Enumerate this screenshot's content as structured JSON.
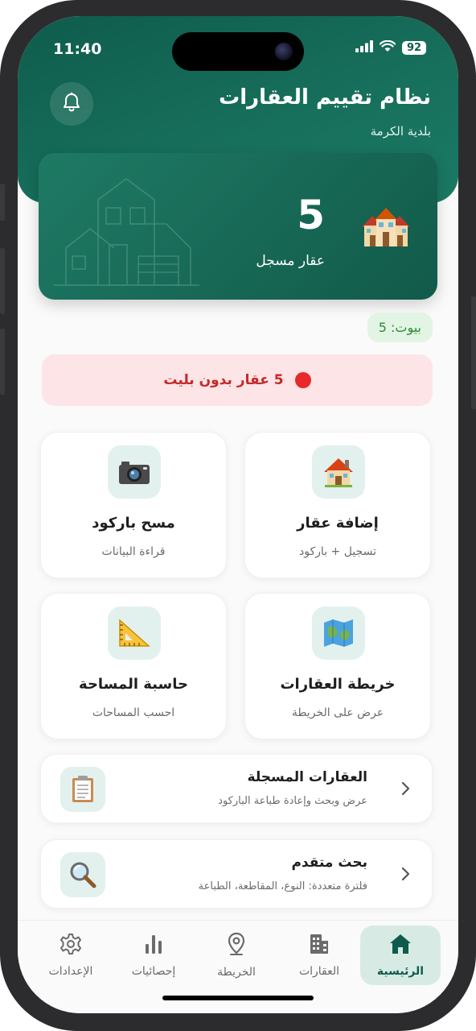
{
  "status_bar": {
    "time": "11:40",
    "battery": "92"
  },
  "header": {
    "title": "نظام تقييم العقارات",
    "subtitle": "بلدية الكرمة"
  },
  "stats": {
    "count": "5",
    "label": "عقار مسجل"
  },
  "homes_badge": "بيوت: 5",
  "alert": {
    "text": "5 عقار بدون بليت",
    "color": "#e8282b"
  },
  "grid": [
    {
      "title": "إضافة عقار",
      "subtitle": "تسجيل + باركود",
      "icon": "house-icon"
    },
    {
      "title": "مسح باركود",
      "subtitle": "قراءة البيانات",
      "icon": "camera-icon"
    },
    {
      "title": "خريطة العقارات",
      "subtitle": "عرض على الخريطة",
      "icon": "map-icon"
    },
    {
      "title": "حاسبة المساحة",
      "subtitle": "احسب المساحات",
      "icon": "triangle-ruler-icon"
    }
  ],
  "list": [
    {
      "title": "العقارات المسجلة",
      "subtitle": "عرض وبحث وإعادة طباعة الباركود",
      "icon": "clipboard-icon"
    },
    {
      "title": "بحث متقدم",
      "subtitle": "فلترة متعددة: النوع، المقاطعة، الطباعة",
      "icon": "magnifier-icon"
    }
  ],
  "nav": [
    {
      "label": "الرئيسية",
      "icon": "home-icon",
      "active": true
    },
    {
      "label": "العقارات",
      "icon": "buildings-icon",
      "active": false
    },
    {
      "label": "الخريطة",
      "icon": "map-pin-icon",
      "active": false
    },
    {
      "label": "إحصائيات",
      "icon": "bar-chart-icon",
      "active": false
    },
    {
      "label": "الإعدادات",
      "icon": "settings-icon",
      "active": false
    }
  ],
  "colors": {
    "primary": "#0f5c4c",
    "accent_light": "#d7ebe4",
    "alert_bg": "#fde4e6",
    "alert_text": "#c62828",
    "badge_bg": "#e2f4e3",
    "badge_text": "#2e8b3a"
  }
}
